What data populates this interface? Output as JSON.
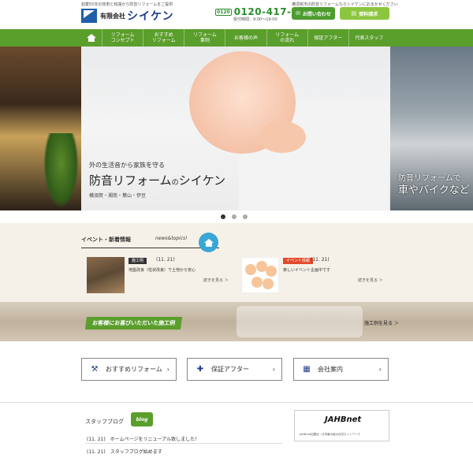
{
  "header": {
    "tagline": "創業55年の技術と知識から防音リフォームをご提供",
    "company_prefix": "有限会社",
    "company_name": "シイケン",
    "right_tagline": "横須賀市の防音リフォームならシイケンにおまかせください",
    "free_dial_mark": "0120",
    "phone": "0120-417-339",
    "hours": "受付時間：9:00～19:00",
    "contact_button": "お問い合わせ",
    "docs_button": "資料請求"
  },
  "nav": {
    "items": [
      {
        "label": "リフォーム\nコンセプト"
      },
      {
        "label": "おすすめ\nリフォーム"
      },
      {
        "label": "リフォーム\n事例"
      },
      {
        "label": "お客様の声"
      },
      {
        "label": "リフォーム\nの流れ"
      },
      {
        "label": "保証アフター"
      },
      {
        "label": "代表スタッフ"
      }
    ]
  },
  "hero": {
    "subtitle": "外の生活音から家族を守る",
    "title_main": "防音リフォーム",
    "title_no": "の",
    "title_brand": "シイケン",
    "area": "横須賀・湘南・葉山・伊豆",
    "right_line1": "防音リフォームで",
    "right_line2": "車やバイクなど"
  },
  "slider": {
    "count": 3,
    "active": 0
  },
  "news": {
    "heading": "イベント・新着情報",
    "topics": "news&topics!",
    "items": [
      {
        "tag": "施工例",
        "date": "(11. 21)",
        "title": "地盤改良（柱状改良）で土地から安心",
        "more": "続きを見る ＞"
      },
      {
        "tag": "イベント情報",
        "date": "(11. 21)",
        "title": "楽しいイベント企画中です",
        "more": "続きを見る ＞"
      }
    ]
  },
  "works": {
    "label": "お客様にお喜びいただいた施工例",
    "more": "施工例を見る ＞"
  },
  "buttons": [
    {
      "icon": "hammer-icon",
      "label": "おすすめリフォーム"
    },
    {
      "icon": "puzzle-icon",
      "label": "保証アフター"
    },
    {
      "icon": "building-icon",
      "label": "会社案内"
    }
  ],
  "blog": {
    "title": "スタッフブログ",
    "badge": "blog",
    "items": [
      {
        "date": "(11. 21)",
        "title": "ホームページをリニューアル致しました！"
      },
      {
        "date": "(11. 21)",
        "title": "スタッフブログ始めます"
      }
    ]
  },
  "jahb": {
    "logo": "JAHBnet",
    "text": "JAHBnet加盟店・日本最大級の住宅ネットワーク"
  },
  "colors": {
    "brand_green": "#5a9e2c",
    "brand_blue": "#1f3d8a",
    "event_red": "#e24a2a",
    "badge_blue": "#3aa6d6"
  }
}
